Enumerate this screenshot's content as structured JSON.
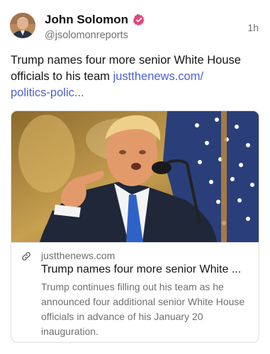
{
  "post": {
    "author_name": "John Solomon",
    "author_handle": "@jsolomonreports",
    "timestamp": "1h",
    "verified": true,
    "text": "Trump names four more senior White House officials to his team ",
    "link_text": "justthenews.com/\npolitics-polic...",
    "accent_color": "#4b5fd6",
    "badge_color": "#e0467d",
    "icons": [
      "avatar",
      "verified-badge-icon",
      "link-icon"
    ]
  },
  "card": {
    "domain": "justthenews.com",
    "title": "Trump names four more senior White ...",
    "description": "Trump continues filling out his team as he announced four additional senior White House officials in advance of his January 20 inauguration."
  }
}
